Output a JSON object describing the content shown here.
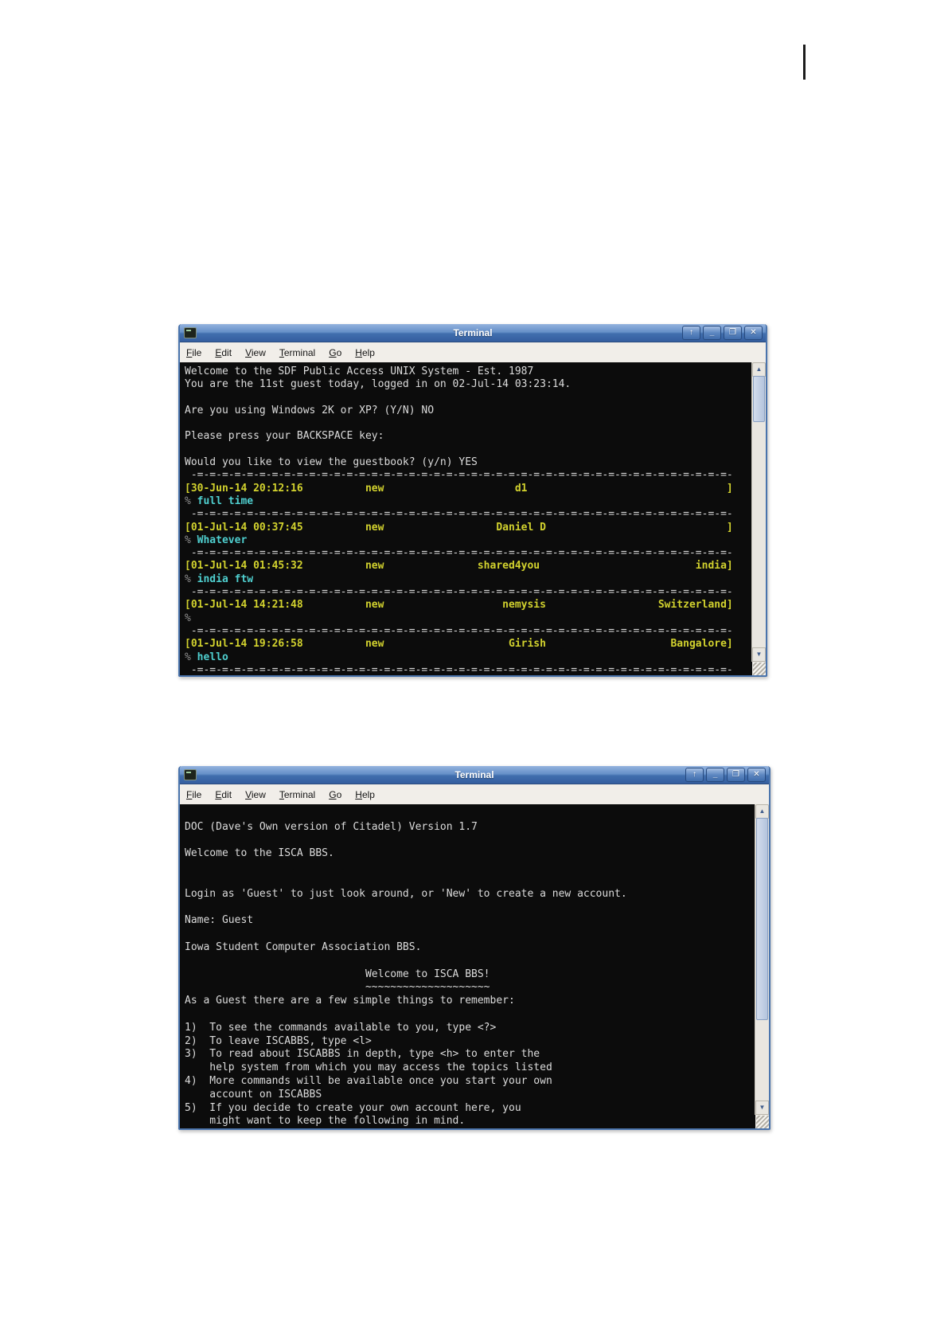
{
  "page": {
    "marker_present": true
  },
  "colors": {
    "terminal_bg": "#0c0c0c",
    "text_white": "#dcdcdc",
    "text_yellow": "#d2d22e",
    "text_cyan": "#4fcfcf",
    "titlebar_blue": "#416fae"
  },
  "icons": {
    "terminal_icon": "terminal",
    "rollup": "↑",
    "minimize": "_",
    "maximize": "❐",
    "close": "✕",
    "scroll_up": "▲",
    "scroll_down": "▼"
  },
  "sep_line": " -=-=-=-=-=-=-=-=-=-=-=-=-=-=-=-=-=-=-=-=-=-=-=-=-=-=-=-=-=-=-=-=-=-=-=-=-=-=-=-=-=-=-=-",
  "window1": {
    "title": "Terminal",
    "menu": [
      "File",
      "Edit",
      "View",
      "Terminal",
      "Go",
      "Help"
    ],
    "lines": [
      {
        "c": "w",
        "t": "Welcome to the SDF Public Access UNIX System - Est. 1987"
      },
      {
        "c": "w",
        "t": "You are the 11st guest today, logged in on 02-Jul-14 03:23:14."
      },
      {
        "c": "w",
        "t": ""
      },
      {
        "c": "w",
        "t": "Are you using Windows 2K or XP? (Y/N) NO"
      },
      {
        "c": "w",
        "t": ""
      },
      {
        "c": "w",
        "t": "Please press your BACKSPACE key:"
      },
      {
        "c": "w",
        "t": ""
      },
      {
        "c": "w",
        "t": "Would you like to view the guestbook? (y/n) YES"
      },
      {
        "c": "sep"
      },
      {
        "c": "y",
        "t": "[30-Jun-14 20:12:16          new                     d1                                ]"
      },
      {
        "c": "comment",
        "t": "% full time"
      },
      {
        "c": "sep"
      },
      {
        "c": "y",
        "t": "[01-Jul-14 00:37:45          new                  Daniel D                             ]"
      },
      {
        "c": "comment",
        "t": "% Whatever"
      },
      {
        "c": "sep"
      },
      {
        "c": "y",
        "t": "[01-Jul-14 01:45:32          new               shared4you                         india]"
      },
      {
        "c": "comment",
        "t": "% india ftw"
      },
      {
        "c": "sep"
      },
      {
        "c": "y",
        "t": "[01-Jul-14 14:21:48          new                   nemysis                  Switzerland]"
      },
      {
        "c": "comment",
        "t": "%"
      },
      {
        "c": "sep"
      },
      {
        "c": "y",
        "t": "[01-Jul-14 19:26:58          new                    Girish                    Bangalore]"
      },
      {
        "c": "comment",
        "t": "% hello"
      },
      {
        "c": "sep"
      }
    ]
  },
  "window2": {
    "title": "Terminal",
    "menu": [
      "File",
      "Edit",
      "View",
      "Terminal",
      "Go",
      "Help"
    ],
    "lines": [
      {
        "c": "w",
        "t": ""
      },
      {
        "c": "w",
        "t": "DOC (Dave's Own version of Citadel) Version 1.7"
      },
      {
        "c": "w",
        "t": ""
      },
      {
        "c": "w",
        "t": "Welcome to the ISCA BBS."
      },
      {
        "c": "w",
        "t": ""
      },
      {
        "c": "w",
        "t": ""
      },
      {
        "c": "w",
        "t": "Login as 'Guest' to just look around, or 'New' to create a new account."
      },
      {
        "c": "w",
        "t": ""
      },
      {
        "c": "w",
        "t": "Name: Guest"
      },
      {
        "c": "w",
        "t": ""
      },
      {
        "c": "w",
        "t": "Iowa Student Computer Association BBS."
      },
      {
        "c": "w",
        "t": ""
      },
      {
        "c": "w",
        "t": "                             Welcome to ISCA BBS!"
      },
      {
        "c": "w",
        "t": "                             ~~~~~~~~~~~~~~~~~~~~"
      },
      {
        "c": "w",
        "t": "As a Guest there are a few simple things to remember:"
      },
      {
        "c": "w",
        "t": ""
      },
      {
        "c": "w",
        "t": "1)  To see the commands available to you, type <?>"
      },
      {
        "c": "w",
        "t": "2)  To leave ISCABBS, type <l>"
      },
      {
        "c": "w",
        "t": "3)  To read about ISCABBS in depth, type <h> to enter the"
      },
      {
        "c": "w",
        "t": "    help system from which you may access the topics listed"
      },
      {
        "c": "w",
        "t": "4)  More commands will be available once you start your own"
      },
      {
        "c": "w",
        "t": "    account on ISCABBS"
      },
      {
        "c": "w",
        "t": "5)  If you decide to create your own account here, you"
      },
      {
        "c": "w",
        "t": "    might want to keep the following in mind."
      }
    ]
  }
}
